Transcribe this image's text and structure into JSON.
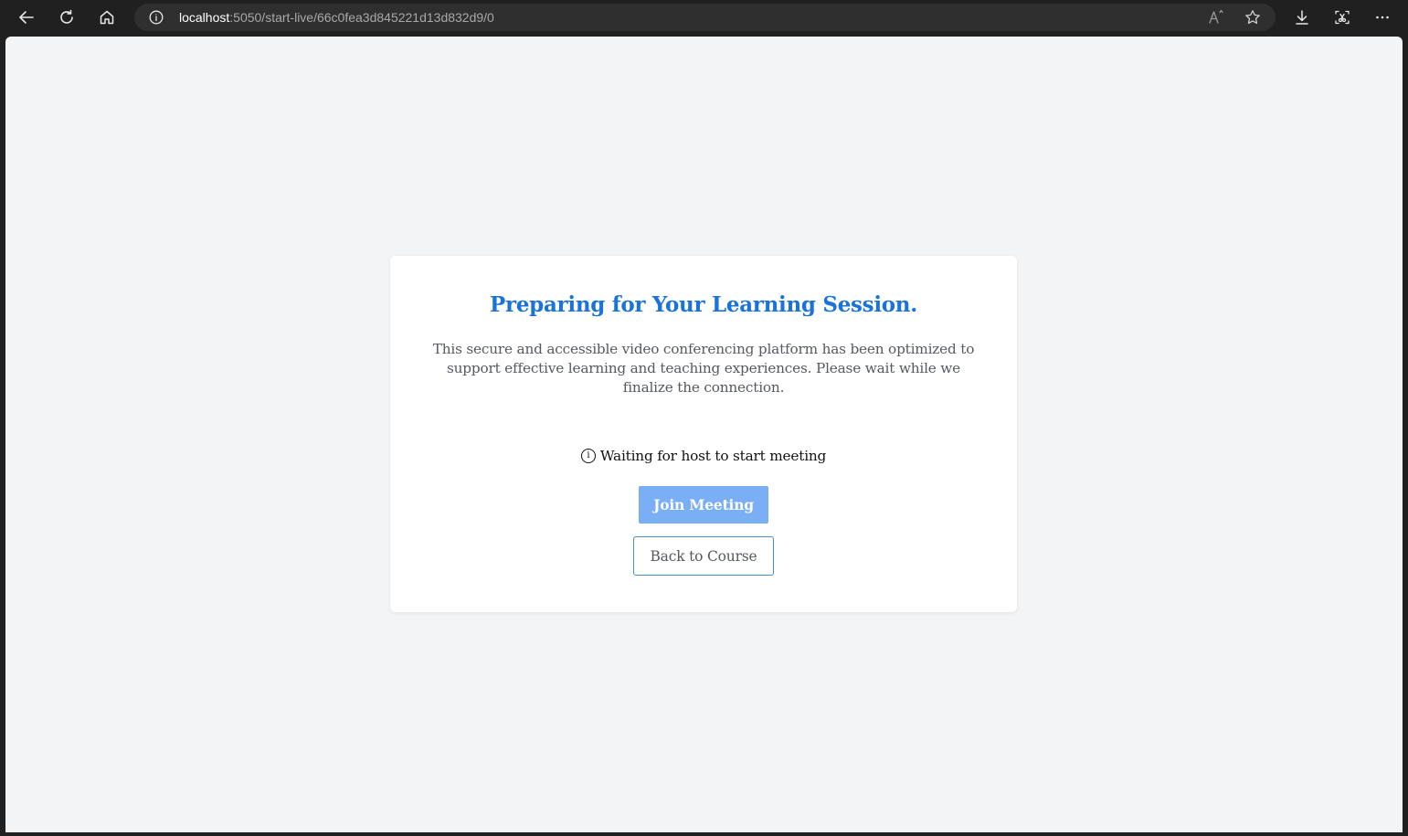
{
  "browser": {
    "url_host": "localhost",
    "url_path": ":5050/start-live/66c0fea3d845221d13d832d9/0",
    "icons": {
      "back": "arrow-left-icon",
      "refresh": "refresh-icon",
      "home": "home-icon",
      "site_info": "info-circle-icon",
      "read_aloud": "read-aloud-icon",
      "favorite": "star-icon",
      "downloads": "download-icon",
      "screenshot": "screenshot-icon",
      "more": "more-dots-icon"
    }
  },
  "card": {
    "title": "Preparing for Your Learning Session.",
    "description": "This secure and accessible video conferencing platform has been optimized to support effective learning and teaching experiences. Please wait while we finalize the connection.",
    "status_icon": "i",
    "status_text": "Waiting for host to start meeting",
    "join_button": "Join Meeting",
    "back_button": "Back to Course"
  },
  "colors": {
    "accent": "#1a73d9",
    "join_button_bg": "#7aaef5",
    "page_bg": "#f3f4f6"
  }
}
